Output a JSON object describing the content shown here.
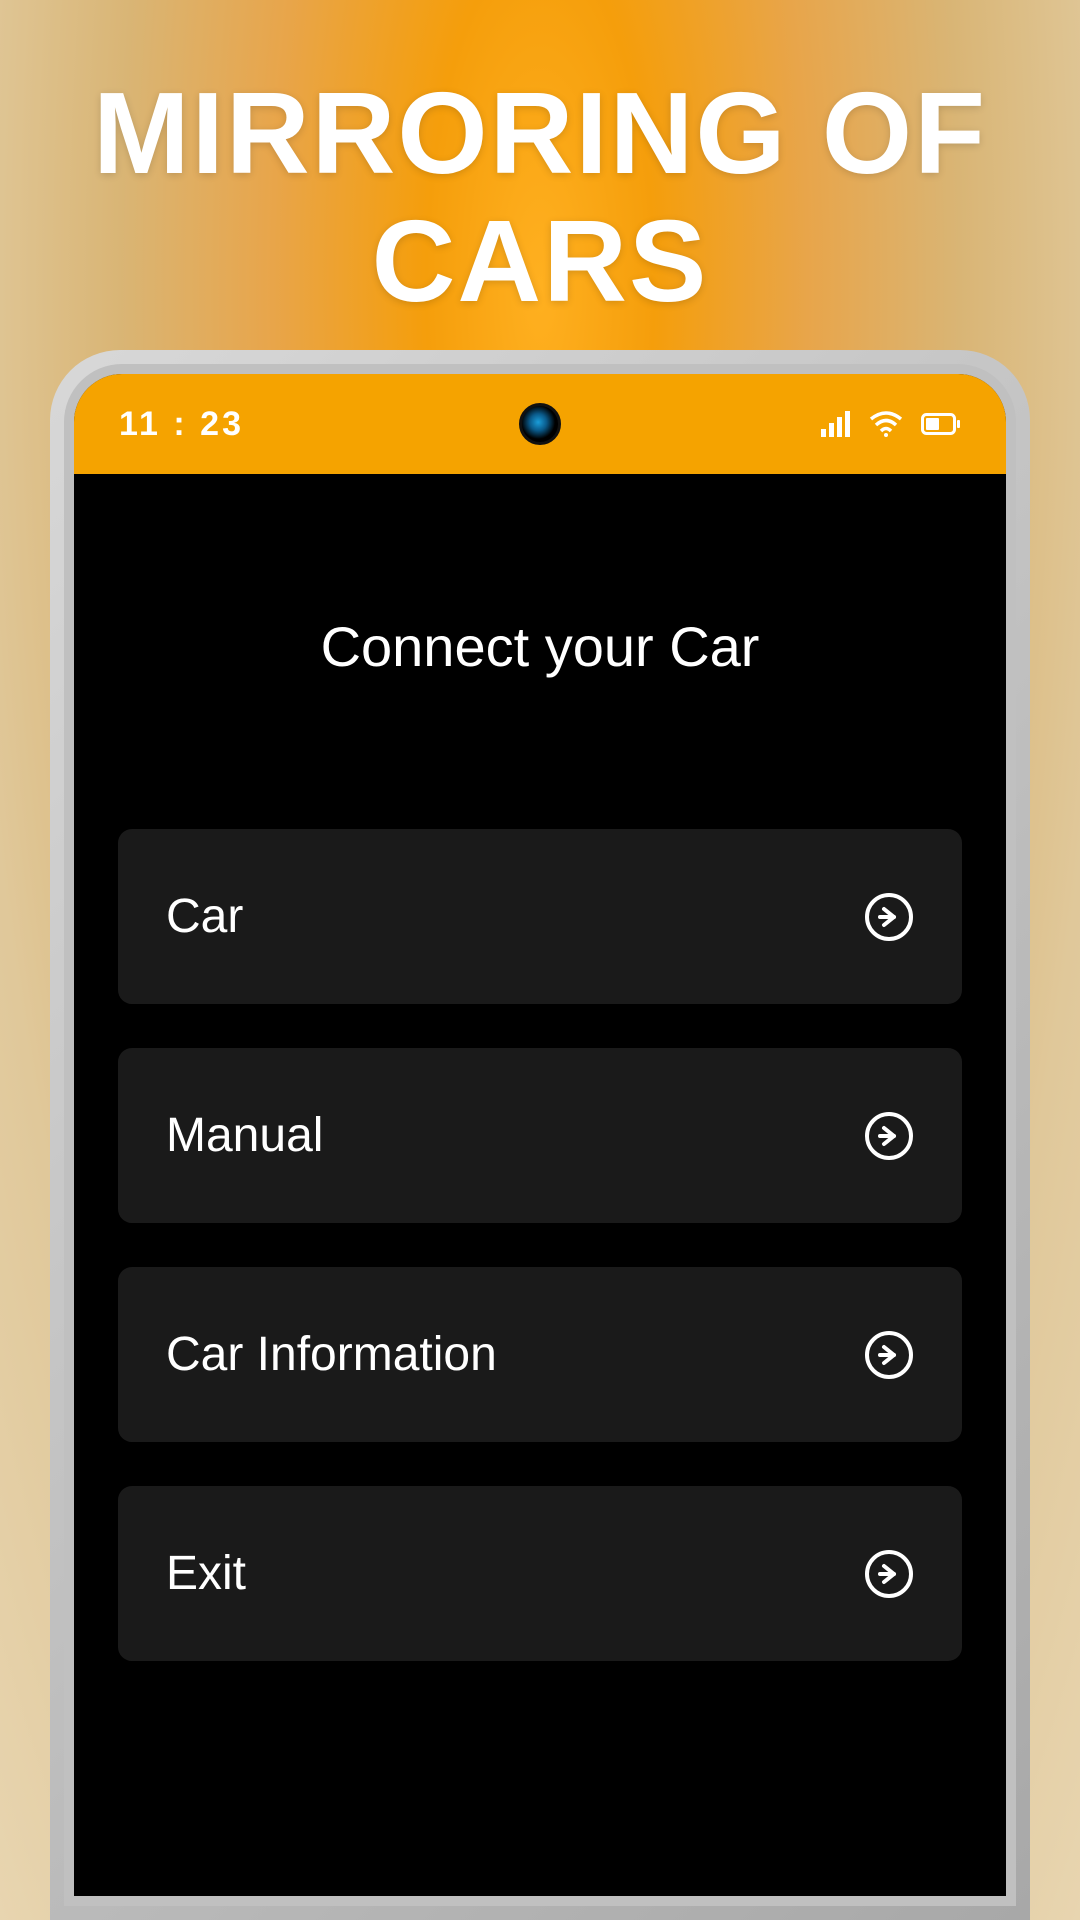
{
  "header": {
    "title_line1": "MIRRORING OF",
    "title_line2": "CARS"
  },
  "status_bar": {
    "time": "11 : 23",
    "accent_color": "#f5a300"
  },
  "screen": {
    "title": "Connect your Car"
  },
  "menu": {
    "items": [
      {
        "label": "Car"
      },
      {
        "label": "Manual"
      },
      {
        "label": "Car Information"
      },
      {
        "label": "Exit"
      }
    ]
  }
}
